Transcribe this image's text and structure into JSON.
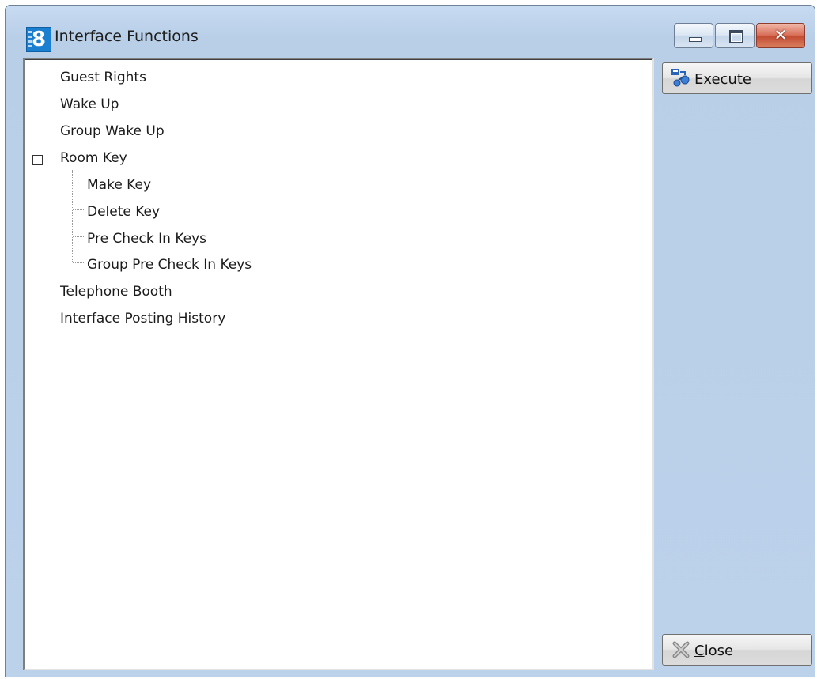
{
  "window": {
    "title": "Interface Functions",
    "app_icon_glyph": "8"
  },
  "caption_buttons": {
    "close_glyph": "✕"
  },
  "tree": {
    "items": [
      {
        "label": "Guest Rights",
        "level": 0
      },
      {
        "label": "Wake Up",
        "level": 0
      },
      {
        "label": "Group Wake Up",
        "level": 0
      },
      {
        "label": "Room Key",
        "level": 0,
        "expanded": true
      },
      {
        "label": "Make Key",
        "level": 1
      },
      {
        "label": "Delete Key",
        "level": 1
      },
      {
        "label": "Pre Check In Keys",
        "level": 1
      },
      {
        "label": "Group Pre Check In Keys",
        "level": 1
      },
      {
        "label": "Telephone Booth",
        "level": 0
      },
      {
        "label": "Interface Posting History",
        "level": 0
      }
    ]
  },
  "buttons": {
    "execute": {
      "prefix": "E",
      "mnemonic": "x",
      "suffix": "ecute",
      "icon": "execute-icon"
    },
    "close": {
      "prefix": "",
      "mnemonic": "C",
      "suffix": "lose",
      "icon": "close-icon"
    }
  },
  "colors": {
    "window_bg": "#bcd1ea",
    "close_button": "#c24a31",
    "app_icon": "#1a7fd0"
  }
}
